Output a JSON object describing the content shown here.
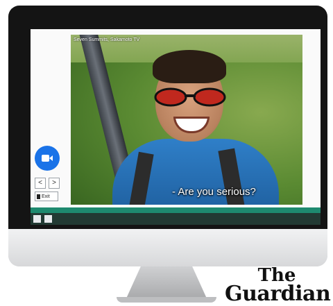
{
  "video": {
    "credit": "Seven Summits, Sakamoto TV",
    "subtitle": "- Are you serious?"
  },
  "controls": {
    "camera_icon": "video-camera-icon",
    "prev_label": "<",
    "next_label": ">",
    "exit_label": "Exit"
  },
  "taskbar": {
    "icons": [
      "menu-icon",
      "screen-share-icon"
    ]
  },
  "logo": {
    "line1": "The",
    "line2": "Guardian"
  },
  "colors": {
    "accent": "#1a73e8",
    "taskbar_green": "#1e8a6f"
  }
}
